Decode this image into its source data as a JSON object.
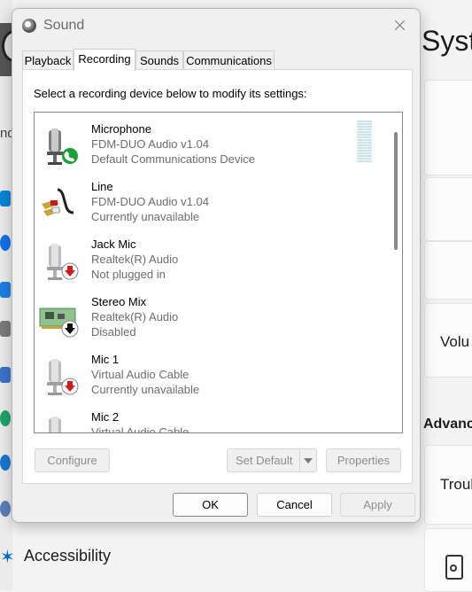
{
  "background": {
    "page_title_fragment": "Syst",
    "search_fragment": "nd",
    "volume_fragment": "Volu",
    "advanced_fragment": "Advanc",
    "troubleshoot_fragment": "Troul",
    "accessibility_label": "Accessibility"
  },
  "dialog": {
    "title": "Sound",
    "tabs": [
      {
        "label": "Playback",
        "active": false
      },
      {
        "label": "Recording",
        "active": true
      },
      {
        "label": "Sounds",
        "active": false
      },
      {
        "label": "Communications",
        "active": false
      }
    ],
    "instruction": "Select a recording device below to modify its settings:",
    "devices": [
      {
        "name": "Microphone",
        "driver": "FDM-DUO Audio v1.04",
        "status": "Default Communications Device",
        "icon": "microphone-icon",
        "badge": "phone-badge-green"
      },
      {
        "name": "Line",
        "driver": "FDM-DUO Audio v1.04",
        "status": "Currently unavailable",
        "icon": "line-in-cable-icon",
        "badge": "none"
      },
      {
        "name": "Jack Mic",
        "driver": "Realtek(R) Audio",
        "status": "Not plugged in",
        "icon": "microphone-icon",
        "badge": "down-arrow-red"
      },
      {
        "name": "Stereo Mix",
        "driver": "Realtek(R) Audio",
        "status": "Disabled",
        "icon": "sound-card-icon",
        "badge": "down-arrow-black"
      },
      {
        "name": "Mic 1",
        "driver": "Virtual Audio Cable",
        "status": "Currently unavailable",
        "icon": "microphone-icon",
        "badge": "down-arrow-red"
      },
      {
        "name": "Mic 2",
        "driver": "Virtual Audio Cable",
        "status": "",
        "icon": "microphone-icon",
        "badge": "none"
      }
    ],
    "buttons": {
      "configure": "Configure",
      "set_default": "Set Default",
      "properties": "Properties",
      "ok": "OK",
      "cancel": "Cancel",
      "apply": "Apply"
    },
    "colors": {
      "badge_green": "#1f9d3a",
      "badge_red": "#d01c1c",
      "level_meter": "#c8e4ee"
    }
  }
}
